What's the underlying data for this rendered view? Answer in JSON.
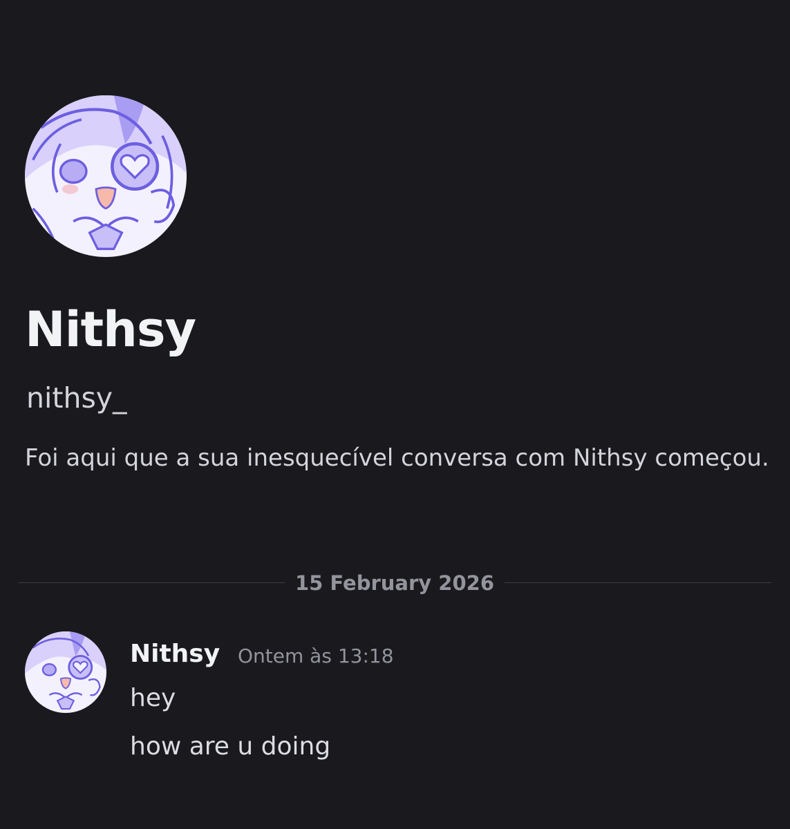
{
  "profile": {
    "display_name": "Nithsy",
    "username": "nithsy_",
    "intro_text": "Foi aqui que a sua inesquecível conversa com Nithsy começou."
  },
  "divider": {
    "date": "15 February 2026"
  },
  "message": {
    "author": "Nithsy",
    "timestamp": "Ontem às 13:18",
    "lines": [
      "hey",
      "how are u doing"
    ]
  },
  "colors": {
    "background": "#1a1a1e",
    "avatar_purple": "#7b6ee6",
    "avatar_light": "#d9d0fb",
    "text_primary": "#f2f3f5",
    "text_muted": "#93949c"
  },
  "icons": {
    "profile_avatar": "anime-avatar-icon",
    "message_avatar": "anime-avatar-icon"
  }
}
